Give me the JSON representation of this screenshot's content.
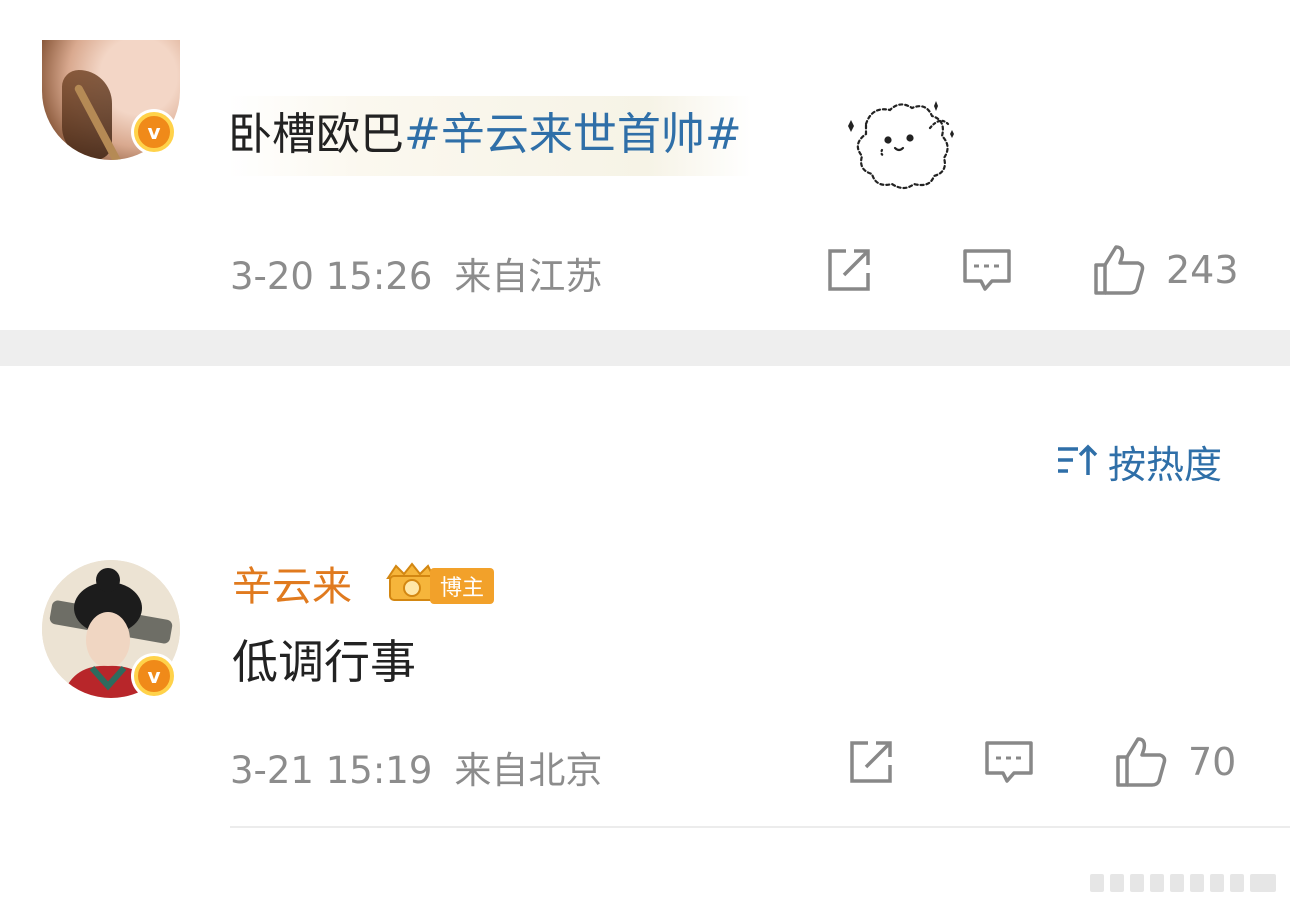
{
  "post": {
    "text_plain": "卧槽欧巴",
    "hashtag": "#辛云来世首帅#",
    "timestamp": "3-20 15:26",
    "location": "来自江苏",
    "likes": "243",
    "icons": {
      "share": "share-icon",
      "comment": "comment-icon",
      "like": "thumbs-up-icon",
      "sticker": "fluffy-dog-sticker"
    }
  },
  "sort": {
    "label": "按热度",
    "icon": "sort-icon"
  },
  "reply": {
    "username": "辛云来",
    "badge_label": "博主",
    "verified_glyph": "v",
    "text": "低调行事",
    "timestamp": "3-21 15:19",
    "location": "来自北京",
    "likes": "70"
  },
  "colors": {
    "hashtag": "#2f6fa8",
    "username": "#e07a1e",
    "meta": "#8c8c8c",
    "verified": "#f08a19",
    "divider": "#eeeeee"
  }
}
